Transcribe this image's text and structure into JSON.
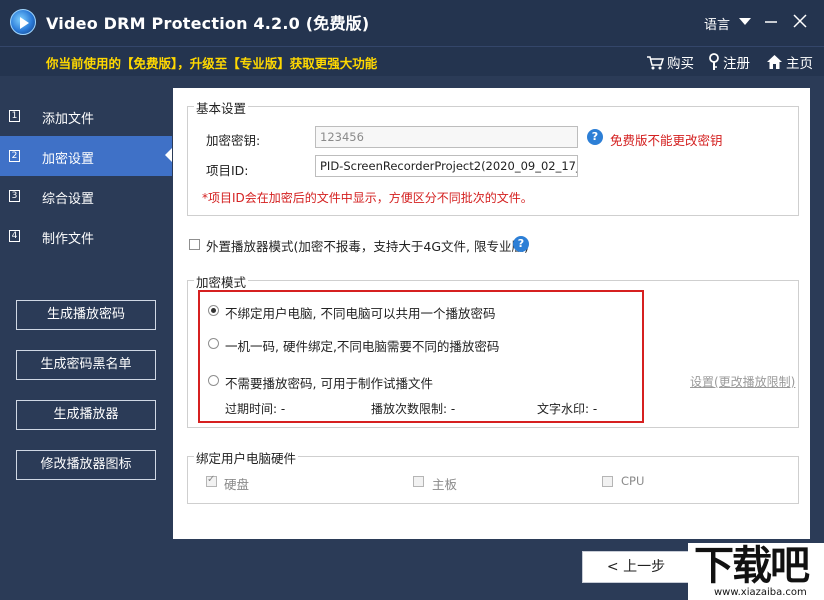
{
  "titlebar": {
    "title": "Video DRM Protection 4.2.0 (免费版)",
    "language": "语言"
  },
  "banner": {
    "message": "你当前使用的【免费版】，升级至【专业版】获取更强大功能",
    "buy": "购买",
    "register": "注册",
    "home": "主页"
  },
  "sidebar": {
    "items": [
      {
        "num": "1",
        "label": "添加文件"
      },
      {
        "num": "2",
        "label": "加密设置"
      },
      {
        "num": "3",
        "label": "综合设置"
      },
      {
        "num": "4",
        "label": "制作文件"
      }
    ],
    "buttons": [
      "生成播放密码",
      "生成密码黑名单",
      "生成播放器",
      "修改播放器图标"
    ]
  },
  "basic": {
    "title": "基本设置",
    "key_label": "加密密钥:",
    "key_value": "123456",
    "key_note": "免费版不能更改密钥",
    "project_label": "项目ID:",
    "project_value": "PID-ScreenRecorderProject2(2020_09_02_17_03_12_",
    "project_note": "*项目ID会在加密后的文件中显示，方便区分不同批次的文件。"
  },
  "external": {
    "label": "外置播放器模式(加密不报毒，支持大于4G文件, 限专业版)"
  },
  "mode": {
    "title": "加密模式",
    "options": [
      "不绑定用户电脑, 不同电脑可以共用一个播放密码",
      "一机一码, 硬件绑定,不同电脑需要不同的播放密码",
      "不需要播放密码, 可用于制作试播文件"
    ],
    "expire": "过期时间: -",
    "play_limit": "播放次数限制: -",
    "watermark": "文字水印: -",
    "settings_link": "设置(更改播放限制)"
  },
  "hardware": {
    "title": "绑定用户电脑硬件",
    "disk": "硬盘",
    "board": "主板",
    "cpu": "CPU"
  },
  "footer": {
    "prev": "< 上一步"
  },
  "watermark": {
    "main": "下载吧",
    "sub": "www.xiazaiba.com"
  }
}
